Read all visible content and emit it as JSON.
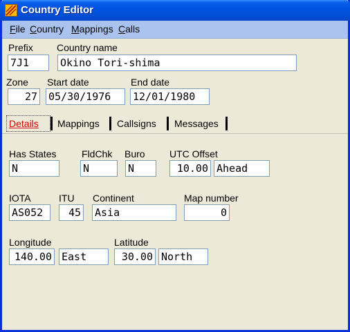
{
  "window": {
    "title": "Country Editor"
  },
  "menu": [
    {
      "hot": "F",
      "rest": "ile"
    },
    {
      "hot": "C",
      "rest": "ountry"
    },
    {
      "hot": "M",
      "rest": "appings"
    },
    {
      "hot": "C",
      "rest": "alls"
    }
  ],
  "header": {
    "prefix_label": "Prefix",
    "prefix": "7J1",
    "country_label": "Country name",
    "country": "Okino Tori-shima",
    "zone_label": "Zone",
    "zone": "27",
    "start_label": "Start date",
    "start": "05/30/1976",
    "end_label": "End date",
    "end": "12/01/1980"
  },
  "tabs": [
    "Details",
    "Mappings",
    "Callsigns",
    "Messages"
  ],
  "details": {
    "has_states_label": "Has States",
    "has_states": "N",
    "fldchk_label": "FldChk",
    "fldchk": "N",
    "buro_label": "Buro",
    "buro": "N",
    "utc_label": "UTC Offset",
    "utc": "10.00",
    "utc_dir": "Ahead",
    "iota_label": "IOTA",
    "iota": "AS052",
    "itu_label": "ITU",
    "itu": "45",
    "continent_label": "Continent",
    "continent": "Asia",
    "map_label": "Map number",
    "map": "0",
    "lon_label": "Longitude",
    "lon": "140.00",
    "lon_dir": "East",
    "lat_label": "Latitude",
    "lat": "30.00",
    "lat_dir": "North"
  }
}
